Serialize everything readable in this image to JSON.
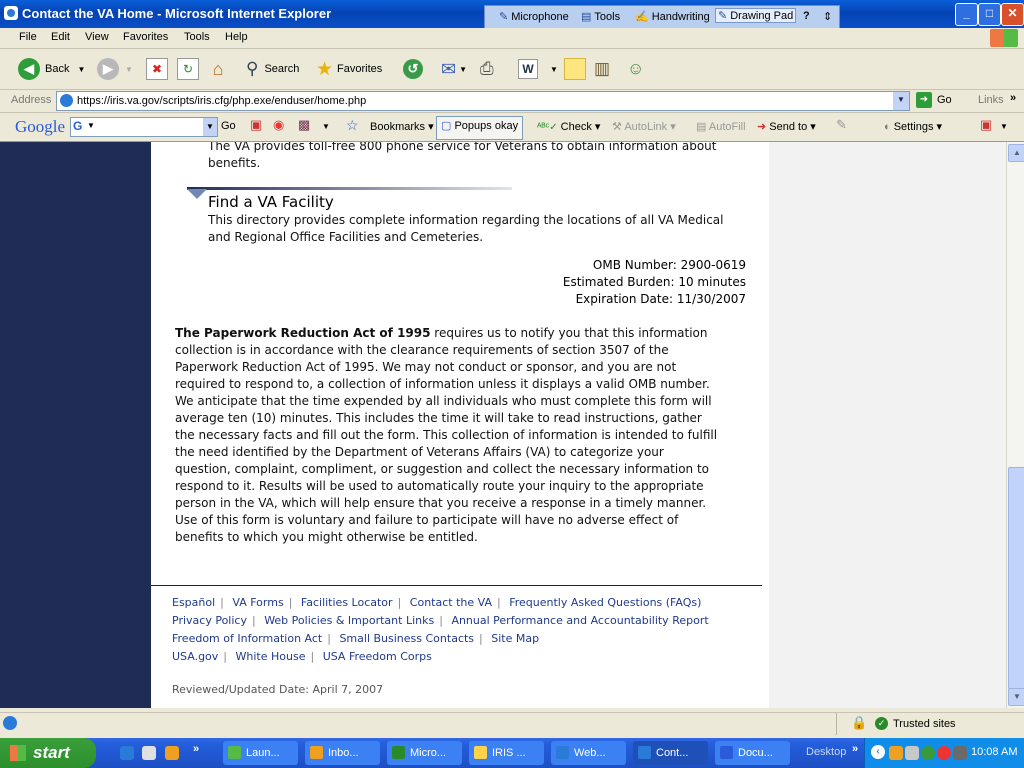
{
  "window": {
    "title": "Contact the VA Home - Microsoft Internet Explorer",
    "language_bar": [
      "Microphone",
      "Tools",
      "Handwriting",
      "Drawing Pad"
    ],
    "language_bar_help": "?",
    "controls": {
      "minimize": "_",
      "maximize": "□",
      "close": "✕"
    }
  },
  "menu": [
    "File",
    "Edit",
    "View",
    "Favorites",
    "Tools",
    "Help"
  ],
  "toolbar": {
    "back": "Back",
    "search": "Search",
    "favorites": "Favorites"
  },
  "address": {
    "label": "Address",
    "url": "https://iris.va.gov/scripts/iris.cfg/php.exe/enduser/home.php",
    "go": "Go",
    "links": "Links"
  },
  "google_toolbar": {
    "logo": "Google",
    "go": "Go",
    "bookmarks": "Bookmarks",
    "popups": "Popups okay",
    "check": "Check",
    "autolink": "AutoLink",
    "autofill": "AutoFill",
    "send_to": "Send to",
    "settings": "Settings"
  },
  "page": {
    "intro_text": "The VA provides toll-free 800 phone service for Veterans to obtain information about benefits.",
    "facility_heading": "Find a VA Facility",
    "facility_text": "This directory provides complete information regarding the locations of all VA Medical and Regional Office Facilities and Cemeteries.",
    "omb_number": "OMB Number: 2900-0619",
    "burden": "Estimated Burden: 10 minutes",
    "expiration": "Expiration Date: 11/30/2007",
    "pra_title": "The Paperwork Reduction Act of 1995",
    "pra_lines": [
      " requires us to notify you that this information",
      "collection is in accordance with the clearance requirements of section 3507 of the",
      "Paperwork Reduction Act of 1995. We may not conduct or sponsor, and you are not",
      "required to respond to, a collection of information unless it displays a valid OMB number.",
      "We anticipate that the time expended by all individuals who must complete this form will",
      "average ten (10) minutes. This includes the time it will take to read instructions, gather",
      "the necessary facts and fill out the form. This collection of information is intended to fulfill",
      "the need identified by the Department of Veterans Affairs (VA) to categorize your",
      "question, complaint, compliment, or suggestion and collect the necessary information to",
      "respond to it. Results will be used to automatically route your inquiry to the appropriate",
      "person in the VA, which will help ensure that you receive a response in a timely manner.",
      "Use of this form is voluntary and failure to participate will have no adverse effect of",
      "benefits to which you might otherwise be entitled."
    ],
    "footer_links": [
      [
        "Español",
        "VA Forms",
        "Facilities Locator",
        "Contact the VA",
        "Frequently Asked Questions (FAQs)"
      ],
      [
        "Privacy Policy",
        "Web Policies & Important Links",
        "Annual Performance and Accountability Report"
      ],
      [
        "Freedom of Information Act",
        "Small Business Contacts",
        "Site Map"
      ],
      [
        "USA.gov",
        "White House",
        "USA Freedom Corps"
      ]
    ],
    "reviewed": "Reviewed/Updated Date: April 7, 2007"
  },
  "status": {
    "zone": "Trusted sites"
  },
  "taskbar": {
    "start": "start",
    "tasks": [
      "Laun...",
      "Inbo...",
      "Micro...",
      "IRIS ...",
      "Web...",
      "Cont...",
      "Docu..."
    ],
    "desktop": "Desktop",
    "clock": "10:08 AM"
  },
  "colors": {
    "left_nav": "#1f2c56",
    "link": "#1f3a8a",
    "title_bar": "#0a5fd8"
  }
}
